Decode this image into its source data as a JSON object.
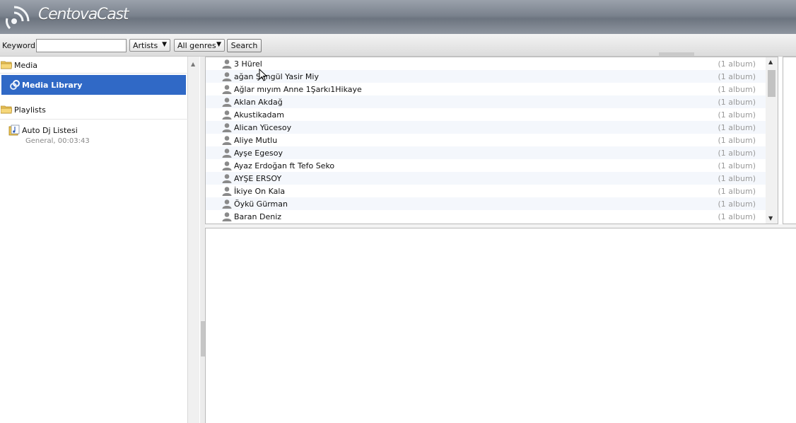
{
  "header": {
    "logo_text": "CentovaCast",
    "logo_icon": "broadcast-icon"
  },
  "toolbar": {
    "keyword_label": "Keyword:",
    "keyword_value": "",
    "type_select": "Artists",
    "genre_select": "All genres",
    "search_label": "Search"
  },
  "sidebar": {
    "media_label": "Media",
    "media_library_label": "Media Library",
    "playlists_label": "Playlists",
    "playlist": {
      "name": "Auto Dj Listesi",
      "detail": "General, 00:03:43"
    }
  },
  "artists": [
    {
      "name": "3 Hürel",
      "count": "(1 album)"
    },
    {
      "name": "ağan Şengül Yasir Miy",
      "count": "(1 album)"
    },
    {
      "name": "Ağlar mıyım Anne 1Şarkı1Hikaye",
      "count": "(1 album)"
    },
    {
      "name": "Aklan Akdağ",
      "count": "(1 album)"
    },
    {
      "name": "Akustikadam",
      "count": "(1 album)"
    },
    {
      "name": "Alican Yücesoy",
      "count": "(1 album)"
    },
    {
      "name": "Aliye Mutlu",
      "count": "(1 album)"
    },
    {
      "name": "Ayşe Egesoy",
      "count": "(1 album)"
    },
    {
      "name": "Ayaz Erdoğan ft Tefo Seko",
      "count": "(1 album)"
    },
    {
      "name": "AYŞE ERSOY",
      "count": "(1 album)"
    },
    {
      "name": "İkiye On Kala",
      "count": "(1 album)"
    },
    {
      "name": "Öykü Gürman",
      "count": "(1 album)"
    },
    {
      "name": "Baran Deniz",
      "count": "(1 album)"
    }
  ],
  "colors": {
    "selection": "#3069c6",
    "row_alt": "#f4f7fc",
    "count_text": "#9a9a9a"
  }
}
